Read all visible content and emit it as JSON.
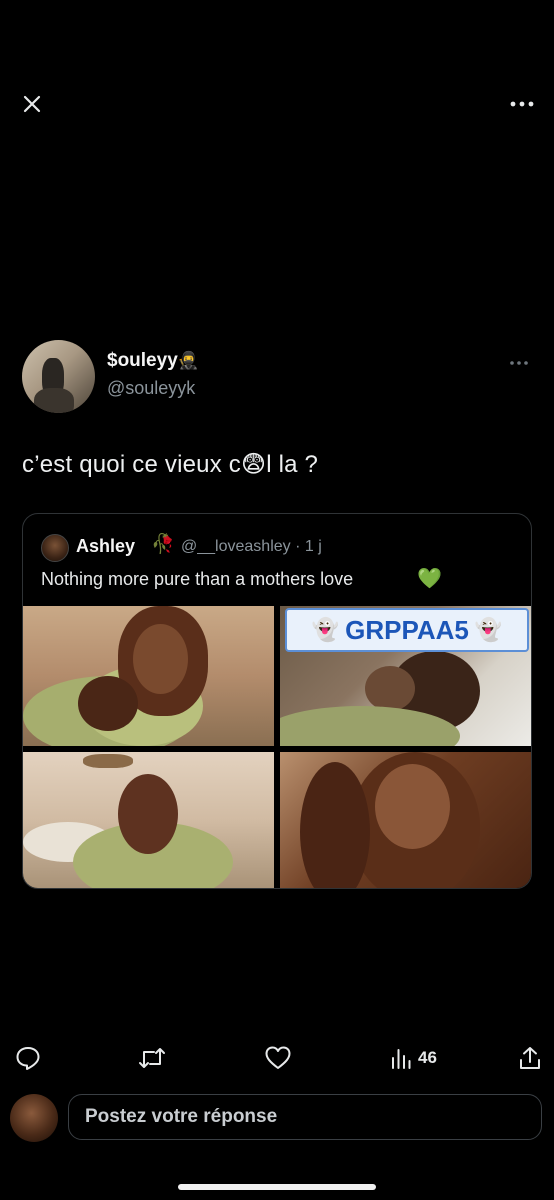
{
  "top_bar": {
    "close_icon": "close-icon",
    "more_icon": "more-horizontal-icon"
  },
  "author": {
    "display_name": "$ouleyy",
    "badge_emoji": "🥷",
    "handle": "@souleyyk"
  },
  "tweet": {
    "text": "c’est quoi ce vieux c😨l la ?"
  },
  "quote": {
    "name": "Ashley",
    "name_emoji": "🥀",
    "handle_time": "@__loveashley · 1 j",
    "text": "Nothing more pure than a mothers love",
    "text_emoji": "💚",
    "watermark": {
      "ghost_left": "👻",
      "label": "GRPPAA5",
      "ghost_right": "👻"
    }
  },
  "actions": {
    "reply_icon": "reply-icon",
    "retweet_icon": "retweet-icon",
    "like_icon": "heart-icon",
    "views_icon": "views-chart-icon",
    "views_count": "46",
    "share_icon": "share-icon"
  },
  "composer": {
    "placeholder": "Postez votre réponse"
  },
  "colors": {
    "background": "#000000",
    "muted": "#8b949b",
    "border": "#2f3336"
  }
}
